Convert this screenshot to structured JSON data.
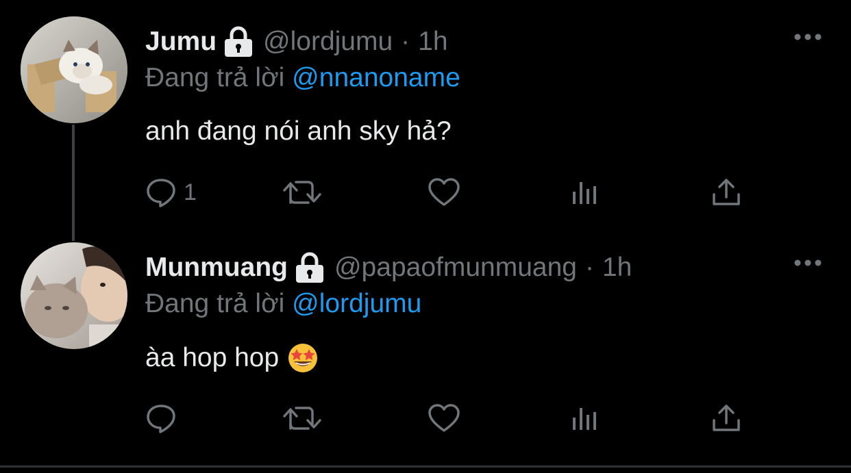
{
  "tweets": [
    {
      "display_name": "Jumu",
      "handle": "@lordjumu",
      "separator": "·",
      "time": "1h",
      "reply_prefix": "Đang trả lời",
      "reply_to": "@nnanoname",
      "text": "anh đang nói anh sky hả?",
      "reply_count": "1",
      "avatar_icon": "cat-avatar-icon"
    },
    {
      "display_name": "Munmuang",
      "handle": "@papaofmunmuang",
      "separator": "·",
      "time": "1h",
      "reply_prefix": "Đang trả lời",
      "reply_to": "@lordjumu",
      "text": "àa hop hop",
      "emoji": "star-struck-emoji-icon",
      "reply_count": "",
      "avatar_icon": "person-with-cat-avatar-icon"
    }
  ],
  "colors": {
    "background": "#000000",
    "primary_text": "#e7e9ea",
    "secondary_text": "#71767b",
    "accent": "#1d9bf0",
    "thread_line": "#3e4144"
  },
  "icons": {
    "locked": "lock-icon",
    "more": "more-icon",
    "reply": "reply-icon",
    "retweet": "retweet-icon",
    "like": "heart-icon",
    "stats": "stats-icon",
    "share": "share-icon"
  }
}
